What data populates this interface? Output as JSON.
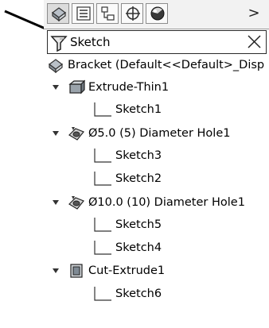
{
  "toolbar": {
    "tabs": [
      {
        "name": "feature-manager-tab",
        "icon": "feature-manager-icon"
      },
      {
        "name": "property-manager-tab",
        "icon": "property-manager-icon"
      },
      {
        "name": "configuration-manager-tab",
        "icon": "configuration-manager-icon"
      },
      {
        "name": "dimxpert-manager-tab",
        "icon": "dimxpert-icon"
      },
      {
        "name": "display-manager-tab",
        "icon": "display-manager-icon"
      }
    ],
    "more_label": ">"
  },
  "filter": {
    "value": "Sketch",
    "icon": "filter-funnel-icon",
    "clear_icon": "close-icon"
  },
  "tree": {
    "root": {
      "label": "Bracket  (Default<<Default>_Disp",
      "icon": "part-icon"
    },
    "features": [
      {
        "label": "Extrude-Thin1",
        "icon": "extrude-thin-icon",
        "children": [
          "Sketch1"
        ]
      },
      {
        "label": "Ø5.0 (5) Diameter Hole1",
        "icon": "hole-wizard-icon",
        "children": [
          "Sketch3",
          "Sketch2"
        ]
      },
      {
        "label": "Ø10.0 (10) Diameter Hole1",
        "icon": "hole-wizard-icon",
        "children": [
          "Sketch5",
          "Sketch4"
        ]
      },
      {
        "label": "Cut-Extrude1",
        "icon": "cut-extrude-icon",
        "children": [
          "Sketch6"
        ]
      }
    ]
  },
  "colors": {
    "border": "#2a2a2a",
    "toolbar_bg": "#f2f2f2"
  }
}
